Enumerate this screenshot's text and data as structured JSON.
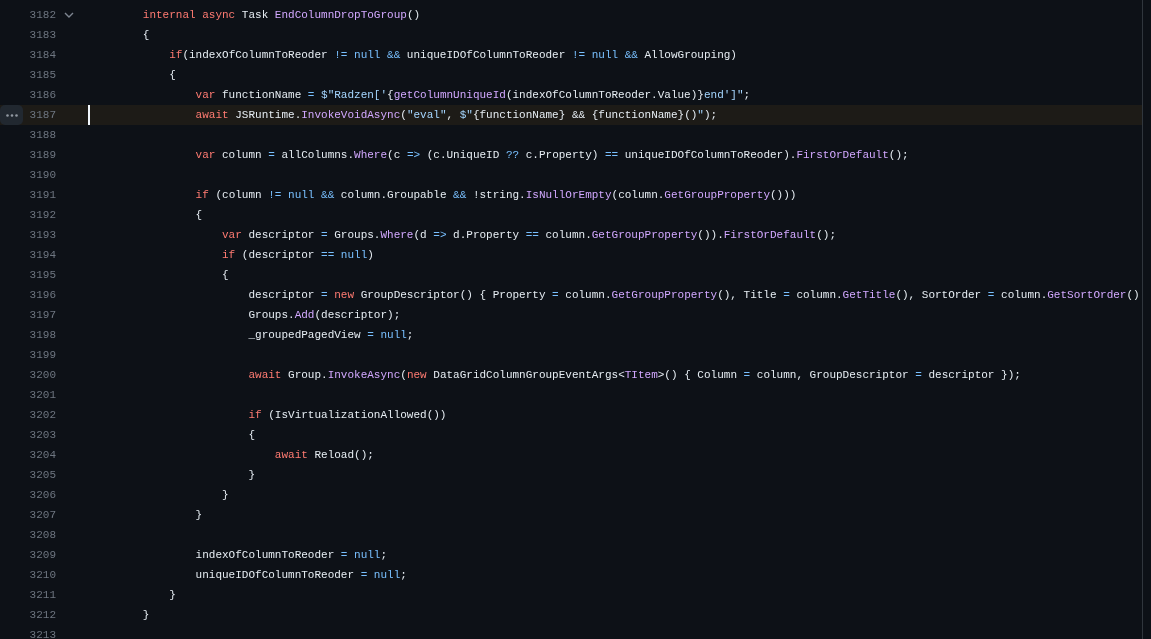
{
  "code": {
    "lines": [
      {
        "number": "3182",
        "selected": false,
        "expanded": true,
        "tokens": [
          {
            "kind": "keyword",
            "text": "        internal async"
          },
          {
            "kind": "plain",
            "text": " Task "
          },
          {
            "kind": "function",
            "text": "EndColumnDropToGroup"
          },
          {
            "kind": "plain",
            "text": "()"
          }
        ]
      },
      {
        "number": "3183",
        "selected": false,
        "tokens": [
          {
            "kind": "plain",
            "text": "        {"
          }
        ]
      },
      {
        "number": "3184",
        "selected": false,
        "tokens": [
          {
            "kind": "keyword",
            "text": "            if"
          },
          {
            "kind": "plain",
            "text": "(indexOfColumnToReoder "
          },
          {
            "kind": "operator",
            "text": "!= null &&"
          },
          {
            "kind": "plain",
            "text": " uniqueIDOfColumnToReoder "
          },
          {
            "kind": "operator",
            "text": "!= null &&"
          },
          {
            "kind": "plain",
            "text": " AllowGrouping)"
          }
        ]
      },
      {
        "number": "3185",
        "selected": false,
        "tokens": [
          {
            "kind": "plain",
            "text": "            {"
          }
        ]
      },
      {
        "number": "3186",
        "selected": false,
        "tokens": [
          {
            "kind": "keyword",
            "text": "                var"
          },
          {
            "kind": "plain",
            "text": " functionName "
          },
          {
            "kind": "operator",
            "text": "= "
          },
          {
            "kind": "string",
            "text": "$\"Radzen['"
          },
          {
            "kind": "plain",
            "text": "{"
          },
          {
            "kind": "function",
            "text": "getColumnUniqueId"
          },
          {
            "kind": "plain",
            "text": "(indexOfColumnToReoder.Value)}"
          },
          {
            "kind": "string",
            "text": "end']\""
          },
          {
            "kind": "plain",
            "text": ";"
          }
        ]
      },
      {
        "number": "3187",
        "selected": true,
        "tokens": [
          {
            "kind": "keyword",
            "text": "                await"
          },
          {
            "kind": "plain",
            "text": " JSRuntime."
          },
          {
            "kind": "function",
            "text": "InvokeVoidAsync"
          },
          {
            "kind": "plain",
            "text": "("
          },
          {
            "kind": "string",
            "text": "\"eval\""
          },
          {
            "kind": "plain",
            "text": ", "
          },
          {
            "kind": "string",
            "text": "$\""
          },
          {
            "kind": "plain",
            "text": "{functionName} && {functionName}()"
          },
          {
            "kind": "string",
            "text": "\""
          },
          {
            "kind": "plain",
            "text": ");"
          }
        ]
      },
      {
        "number": "3188",
        "selected": false
      },
      {
        "number": "3189",
        "selected": false,
        "tokens": [
          {
            "kind": "keyword",
            "text": "                var"
          },
          {
            "kind": "plain",
            "text": " column "
          },
          {
            "kind": "operator",
            "text": "="
          },
          {
            "kind": "plain",
            "text": " allColumns."
          },
          {
            "kind": "function",
            "text": "Where"
          },
          {
            "kind": "plain",
            "text": "(c "
          },
          {
            "kind": "operator",
            "text": "=>"
          },
          {
            "kind": "plain",
            "text": " (c.UniqueID "
          },
          {
            "kind": "operator",
            "text": "??"
          },
          {
            "kind": "plain",
            "text": " c.Property) "
          },
          {
            "kind": "operator",
            "text": "=="
          },
          {
            "kind": "plain",
            "text": " uniqueIDOfColumnToReoder)."
          },
          {
            "kind": "function",
            "text": "FirstOrDefault"
          },
          {
            "kind": "plain",
            "text": "();"
          }
        ]
      },
      {
        "number": "3190",
        "selected": false
      },
      {
        "number": "3191",
        "selected": false,
        "tokens": [
          {
            "kind": "keyword",
            "text": "                if"
          },
          {
            "kind": "plain",
            "text": " (column "
          },
          {
            "kind": "operator",
            "text": "!= null &&"
          },
          {
            "kind": "plain",
            "text": " column.Groupable "
          },
          {
            "kind": "operator",
            "text": "&&"
          },
          {
            "kind": "plain",
            "text": " !string."
          },
          {
            "kind": "function",
            "text": "IsNullOrEmpty"
          },
          {
            "kind": "plain",
            "text": "(column."
          },
          {
            "kind": "function",
            "text": "GetGroupProperty"
          },
          {
            "kind": "plain",
            "text": "()))"
          }
        ]
      },
      {
        "number": "3192",
        "selected": false,
        "tokens": [
          {
            "kind": "plain",
            "text": "                {"
          }
        ]
      },
      {
        "number": "3193",
        "selected": false,
        "tokens": [
          {
            "kind": "keyword",
            "text": "                    var"
          },
          {
            "kind": "plain",
            "text": " descriptor "
          },
          {
            "kind": "operator",
            "text": "="
          },
          {
            "kind": "plain",
            "text": " Groups."
          },
          {
            "kind": "function",
            "text": "Where"
          },
          {
            "kind": "plain",
            "text": "(d "
          },
          {
            "kind": "operator",
            "text": "=>"
          },
          {
            "kind": "plain",
            "text": " d.Property "
          },
          {
            "kind": "operator",
            "text": "=="
          },
          {
            "kind": "plain",
            "text": " column."
          },
          {
            "kind": "function",
            "text": "GetGroupProperty"
          },
          {
            "kind": "plain",
            "text": "())."
          },
          {
            "kind": "function",
            "text": "FirstOrDefault"
          },
          {
            "kind": "plain",
            "text": "();"
          }
        ]
      },
      {
        "number": "3194",
        "selected": false,
        "tokens": [
          {
            "kind": "keyword",
            "text": "                    if"
          },
          {
            "kind": "plain",
            "text": " (descriptor "
          },
          {
            "kind": "operator",
            "text": "== null"
          },
          {
            "kind": "plain",
            "text": ")"
          }
        ]
      },
      {
        "number": "3195",
        "selected": false,
        "tokens": [
          {
            "kind": "plain",
            "text": "                    {"
          }
        ]
      },
      {
        "number": "3196",
        "selected": false,
        "tokens": [
          {
            "kind": "plain",
            "text": "                        descriptor "
          },
          {
            "kind": "operator",
            "text": "= "
          },
          {
            "kind": "keyword",
            "text": "new"
          },
          {
            "kind": "plain",
            "text": " GroupDescriptor() { Property "
          },
          {
            "kind": "operator",
            "text": "="
          },
          {
            "kind": "plain",
            "text": " column."
          },
          {
            "kind": "function",
            "text": "GetGroupProperty"
          },
          {
            "kind": "plain",
            "text": "(), Title "
          },
          {
            "kind": "operator",
            "text": "="
          },
          {
            "kind": "plain",
            "text": " column."
          },
          {
            "kind": "function",
            "text": "GetTitle"
          },
          {
            "kind": "plain",
            "text": "(), SortOrder "
          },
          {
            "kind": "operator",
            "text": "="
          },
          {
            "kind": "plain",
            "text": " column."
          },
          {
            "kind": "function",
            "text": "GetSortOrder"
          },
          {
            "kind": "plain",
            "text": "()"
          }
        ]
      },
      {
        "number": "3197",
        "selected": false,
        "tokens": [
          {
            "kind": "plain",
            "text": "                        Groups."
          },
          {
            "kind": "function",
            "text": "Add"
          },
          {
            "kind": "plain",
            "text": "(descriptor);"
          }
        ]
      },
      {
        "number": "3198",
        "selected": false,
        "tokens": [
          {
            "kind": "plain",
            "text": "                        _groupedPagedView "
          },
          {
            "kind": "operator",
            "text": "= null"
          },
          {
            "kind": "plain",
            "text": ";"
          }
        ]
      },
      {
        "number": "3199",
        "selected": false
      },
      {
        "number": "3200",
        "selected": false,
        "tokens": [
          {
            "kind": "keyword",
            "text": "                        await"
          },
          {
            "kind": "plain",
            "text": " Group."
          },
          {
            "kind": "function",
            "text": "InvokeAsync"
          },
          {
            "kind": "plain",
            "text": "("
          },
          {
            "kind": "keyword",
            "text": "new"
          },
          {
            "kind": "plain",
            "text": " DataGridColumnGroupEventArgs<"
          },
          {
            "kind": "function",
            "text": "TItem"
          },
          {
            "kind": "plain",
            "text": ">() { Column "
          },
          {
            "kind": "operator",
            "text": "="
          },
          {
            "kind": "plain",
            "text": " column, GroupDescriptor "
          },
          {
            "kind": "operator",
            "text": "="
          },
          {
            "kind": "plain",
            "text": " descriptor });"
          }
        ]
      },
      {
        "number": "3201",
        "selected": false
      },
      {
        "number": "3202",
        "selected": false,
        "tokens": [
          {
            "kind": "keyword",
            "text": "                        if"
          },
          {
            "kind": "plain",
            "text": " (IsVirtualizationAllowed())"
          }
        ]
      },
      {
        "number": "3203",
        "selected": false,
        "tokens": [
          {
            "kind": "plain",
            "text": "                        {"
          }
        ]
      },
      {
        "number": "3204",
        "selected": false,
        "tokens": [
          {
            "kind": "keyword",
            "text": "                            await"
          },
          {
            "kind": "plain",
            "text": " Reload();"
          }
        ]
      },
      {
        "number": "3205",
        "selected": false,
        "tokens": [
          {
            "kind": "plain",
            "text": "                        }"
          }
        ]
      },
      {
        "number": "3206",
        "selected": false,
        "tokens": [
          {
            "kind": "plain",
            "text": "                    }"
          }
        ]
      },
      {
        "number": "3207",
        "selected": false,
        "tokens": [
          {
            "kind": "plain",
            "text": "                }"
          }
        ]
      },
      {
        "number": "3208",
        "selected": false
      },
      {
        "number": "3209",
        "selected": false,
        "tokens": [
          {
            "kind": "plain",
            "text": "                indexOfColumnToReoder "
          },
          {
            "kind": "operator",
            "text": "= null"
          },
          {
            "kind": "plain",
            "text": ";"
          }
        ]
      },
      {
        "number": "3210",
        "selected": false,
        "tokens": [
          {
            "kind": "plain",
            "text": "                uniqueIDOfColumnToReoder "
          },
          {
            "kind": "operator",
            "text": "= null"
          },
          {
            "kind": "plain",
            "text": ";"
          }
        ]
      },
      {
        "number": "3211",
        "selected": false,
        "tokens": [
          {
            "kind": "plain",
            "text": "            }"
          }
        ]
      },
      {
        "number": "3212",
        "selected": false,
        "tokens": [
          {
            "kind": "plain",
            "text": "        }"
          }
        ]
      },
      {
        "number": "3213",
        "selected": false
      }
    ]
  }
}
